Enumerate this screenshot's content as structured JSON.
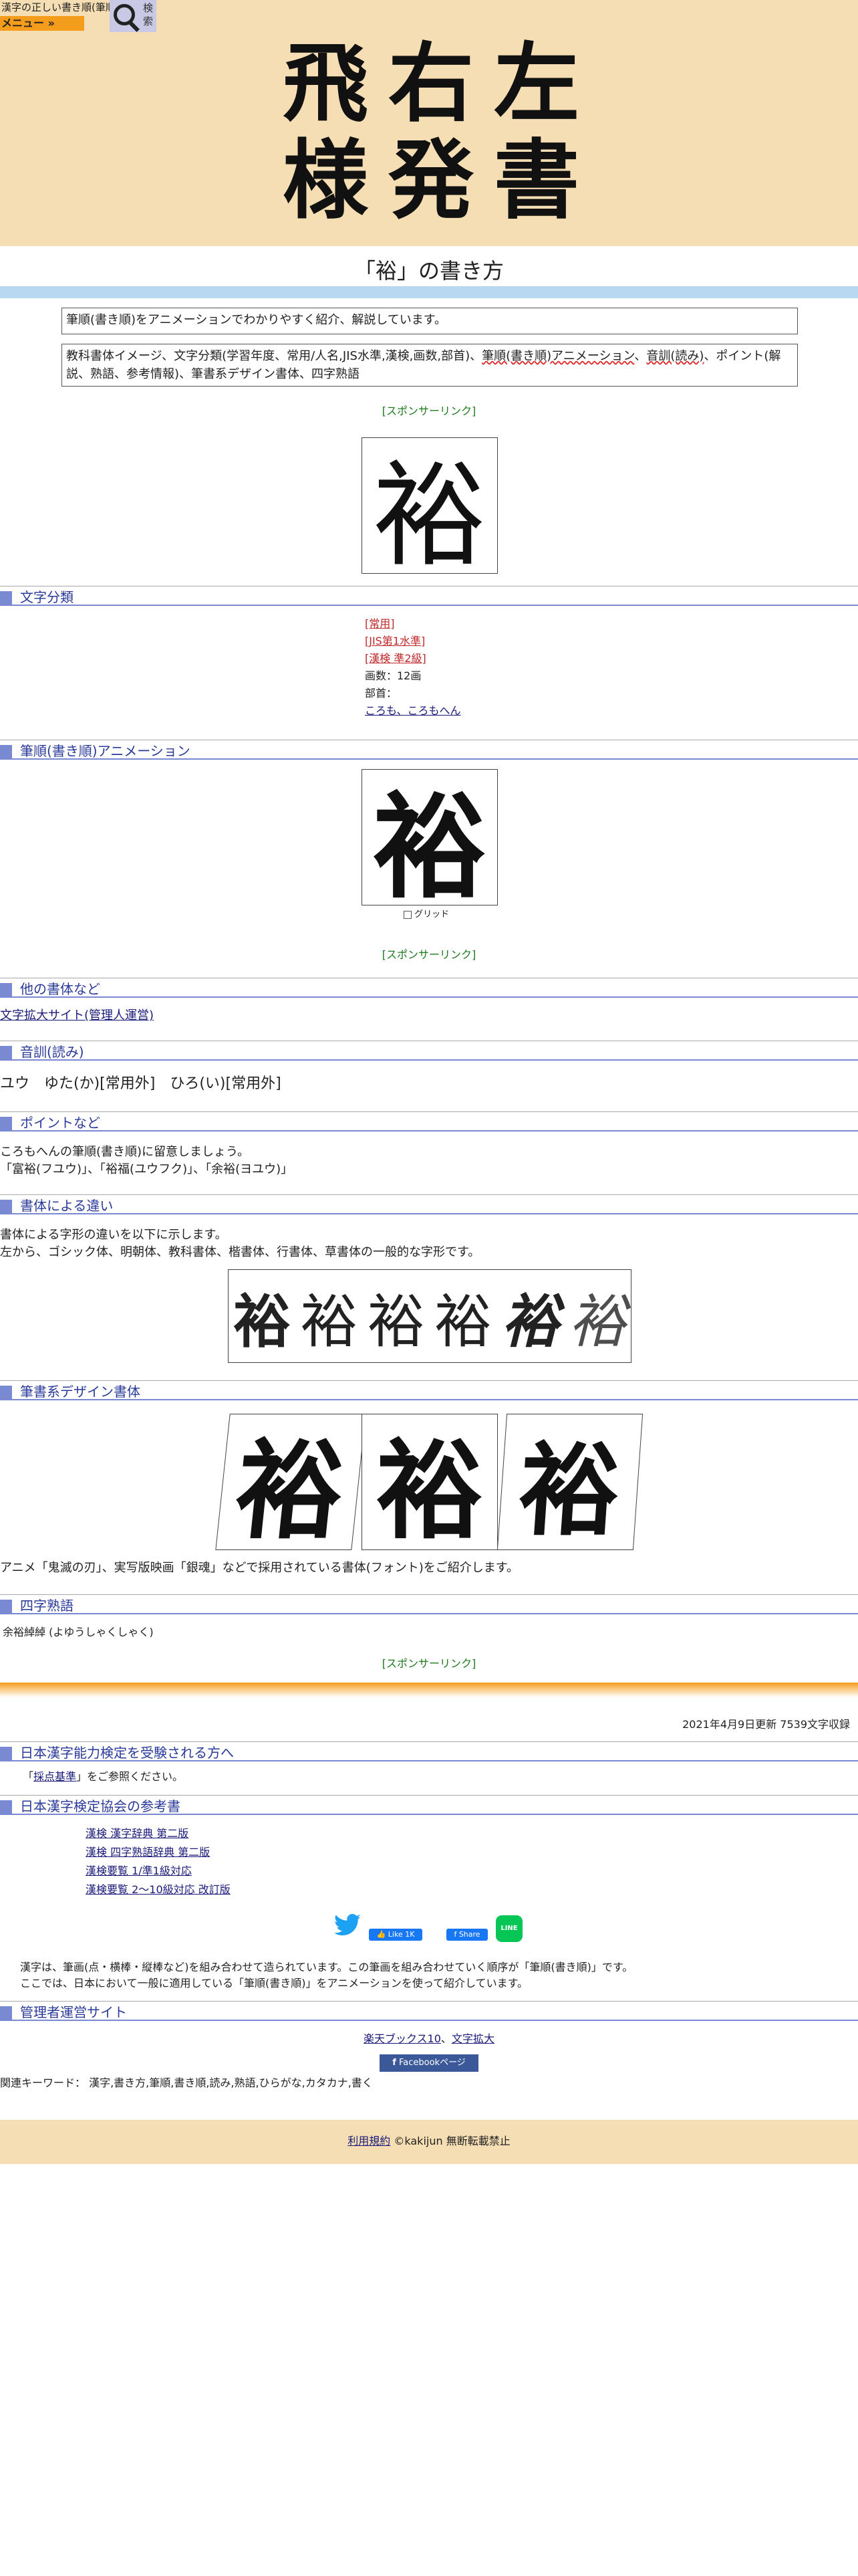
{
  "topbar": {
    "logo_text": "漢字の正しい書き順(筆順)",
    "menu_label": "メニュー »",
    "search_label": "検索"
  },
  "header": {
    "title_line1": "飛右左",
    "title_line2": "様発書"
  },
  "page_title": "「裕」の書き方",
  "intro": {
    "box1": "筆順(書き順)をアニメーションでわかりやすく紹介、解説しています。",
    "box2_part1": "教科書体イメージ、文字分類(学習年度、常用/人名,JIS水準,漢検,画数,部首)、",
    "box2_link1": "筆順(書き順)アニメーション",
    "box2_sep": "、",
    "box2_link2": "音訓(読み)",
    "box2_part2": "、ポイント(解説、熟語、参考情報)、筆書系デザイン書体、四字熟語"
  },
  "sponsor_label": "[スポンサーリンク]",
  "kanji": "裕",
  "sections": {
    "classification": "文字分類",
    "animation": "筆順(書き順)アニメーション",
    "other_fonts": "他の書体など",
    "reading": "音訓(読み)",
    "points": "ポイントなど",
    "font_diff": "書体による違い",
    "brush_design": "筆書系デザイン書体",
    "yoji": "四字熟語",
    "kanken": "日本漢字能力検定を受験される方へ",
    "kanken_ref": "日本漢字検定協会の参考書",
    "admin_sites": "管理者運営サイト"
  },
  "classification": {
    "joyo": "[常用]",
    "jis": "[JIS第1水準]",
    "kanken": "[漢検 準2級]",
    "strokes": "画数：12画",
    "bushu_label": "部首：",
    "bushu_link": "ころも、ころもへん"
  },
  "animation": {
    "grid_label": "グリッド"
  },
  "other_fonts": {
    "link": "文字拡大サイト(管理人運営)"
  },
  "reading": {
    "text": "ユウ　ゆた(か)[常用外]　ひろ(い)[常用外]"
  },
  "points": {
    "line1": "ころもへんの筆順(書き順)に留意しましょう。",
    "line2": "「富裕(フユウ)」、「裕福(ユウフク)」、「余裕(ヨユウ)」"
  },
  "font_diff": {
    "line1": "書体による字形の違いを以下に示します。",
    "line2": "左から、ゴシック体、明朝体、教科書体、楷書体、行書体、草書体の一般的な字形です。"
  },
  "brush_design": {
    "caption": "アニメ「鬼滅の刃」、実写版映画「銀魂」などで採用されている書体(フォント)をご紹介します。"
  },
  "yoji": {
    "text": "余裕綽綽 (よゆうしゃくしゃく)"
  },
  "updated": "2021年4月9日更新 7539文字収録",
  "kanken": {
    "pre": "「",
    "link": "採点基準",
    "post": "」をご参照ください。"
  },
  "kanken_ref": {
    "books": [
      "漢検 漢字辞典 第二版",
      "漢検 四字熟語辞典 第二版",
      "漢検要覧 1/準1級対応",
      "漢検要覧 2～10級対応 改訂版"
    ]
  },
  "social": {
    "like_label": "Like 1K",
    "share_label": "Share",
    "line_label": "LINE"
  },
  "explain": {
    "line1": "漢字は、筆画(点・横棒・縦棒など)を組み合わせて造られています。この筆画を組み合わせていく順序が「筆順(書き順)」です。",
    "line2": "ここでは、日本において一般に適用している「筆順(書き順)」をアニメーションを使って紹介しています。"
  },
  "admin_sites": {
    "link1": "楽天ブックス10",
    "sep": "、",
    "link2": "文字拡大",
    "fb_label": "Facebookページ"
  },
  "keywords": "関連キーワード：  漢字,書き方,筆順,書き順,読み,熟語,ひらがな,カタカナ,書く",
  "footer": {
    "terms": "利用規約",
    "copyright": "©kakijun 無断転載禁止"
  },
  "colors": {
    "header_bg": "#f5deb3",
    "menu_orange": "#f49c1c",
    "section_blue": "#7a8ad2",
    "red_label": "#c0282a",
    "sponsor_green": "#1d7a1d",
    "twitter_blue": "#1da1f2",
    "facebook_blue": "#1877f2",
    "line_green": "#06c755"
  }
}
